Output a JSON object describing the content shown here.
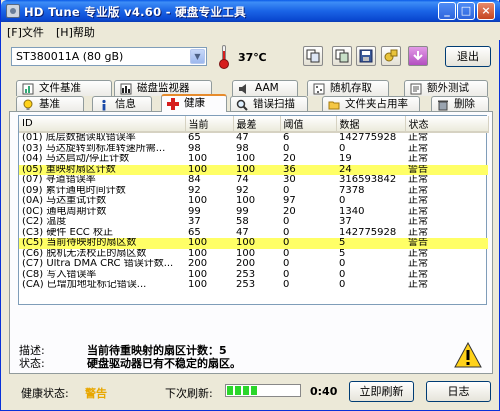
{
  "window": {
    "title": "HD Tune 专业版 v4.60 - 硬盘专业工具"
  },
  "menu": {
    "file": "[F]文件",
    "help": "[H]帮助"
  },
  "toolbar": {
    "drive": "ST380011A (80 gB)",
    "temperature": "37℃",
    "exit_label": "退出",
    "icons": [
      "copy-icon",
      "copy-screen-icon",
      "save-icon",
      "options-icon",
      "download-icon"
    ]
  },
  "tabs_top": [
    "文件基准",
    "磁盘监视器",
    "AAM",
    "随机存取",
    "额外测试"
  ],
  "tabs_bottom": [
    "基准",
    "信息",
    "健康",
    "错误扫描",
    "文件夹占用率",
    "删除"
  ],
  "active_tab": "健康",
  "table": {
    "headers": [
      "ID",
      "当前",
      "最差",
      "阈值",
      "数据",
      "状态"
    ],
    "rows": [
      {
        "id": "(01) 底层数据读取错误率",
        "cur": "65",
        "worst": "47",
        "thresh": "6",
        "data": "142775928",
        "status": "正常",
        "warn": false
      },
      {
        "id": "(03) 马达旋转到标准转速所需...",
        "cur": "98",
        "worst": "98",
        "thresh": "0",
        "data": "0",
        "status": "正常",
        "warn": false
      },
      {
        "id": "(04) 马达启动/停止计数",
        "cur": "100",
        "worst": "100",
        "thresh": "20",
        "data": "19",
        "status": "正常",
        "warn": false
      },
      {
        "id": "(05) 重映射扇区计数",
        "cur": "100",
        "worst": "100",
        "thresh": "36",
        "data": "24",
        "status": "警告",
        "warn": true
      },
      {
        "id": "(07) 寻道错误率",
        "cur": "84",
        "worst": "74",
        "thresh": "30",
        "data": "316593842",
        "status": "正常",
        "warn": false
      },
      {
        "id": "(09) 累计通电时间计数",
        "cur": "92",
        "worst": "92",
        "thresh": "0",
        "data": "7378",
        "status": "正常",
        "warn": false
      },
      {
        "id": "(0A) 马达重试计数",
        "cur": "100",
        "worst": "100",
        "thresh": "97",
        "data": "0",
        "status": "正常",
        "warn": false
      },
      {
        "id": "(0C) 通电周期计数",
        "cur": "99",
        "worst": "99",
        "thresh": "20",
        "data": "1340",
        "status": "正常",
        "warn": false
      },
      {
        "id": "(C2) 温度",
        "cur": "37",
        "worst": "58",
        "thresh": "0",
        "data": "37",
        "status": "正常",
        "warn": false
      },
      {
        "id": "(C3) 硬件 ECC 校正",
        "cur": "65",
        "worst": "47",
        "thresh": "0",
        "data": "142775928",
        "status": "正常",
        "warn": false
      },
      {
        "id": "(C5) 当前待映射的扇区数",
        "cur": "100",
        "worst": "100",
        "thresh": "0",
        "data": "5",
        "status": "警告",
        "warn": true
      },
      {
        "id": "(C6) 脱机无法校正的扇区数",
        "cur": "100",
        "worst": "100",
        "thresh": "0",
        "data": "5",
        "status": "正常",
        "warn": false
      },
      {
        "id": "(C7) Ultra DMA CRC 错误计数...",
        "cur": "200",
        "worst": "200",
        "thresh": "0",
        "data": "0",
        "status": "正常",
        "warn": false
      },
      {
        "id": "(C8) 写入错误率",
        "cur": "100",
        "worst": "253",
        "thresh": "0",
        "data": "0",
        "status": "正常",
        "warn": false
      },
      {
        "id": "(CA) 已增加地址标记错误...",
        "cur": "100",
        "worst": "253",
        "thresh": "0",
        "data": "0",
        "status": "正常",
        "warn": false
      }
    ]
  },
  "description": {
    "desc_label": "描述:",
    "desc_value": "当前待重映射的扇区计数：5",
    "state_label": "状态:",
    "state_value": "硬盘驱动器已有不稳定的扇区。"
  },
  "status": {
    "health_label": "健康状态:",
    "health_value": "警告",
    "next_refresh_label": "下次刷新:",
    "progress_fraction": 0.45,
    "timer": "0:40",
    "refresh_button": "立即刷新",
    "log_button": "日志"
  },
  "colors": {
    "warning_row": "#ffff66",
    "warning_text": "#e8a700",
    "title_bar": "#0a48d0"
  }
}
